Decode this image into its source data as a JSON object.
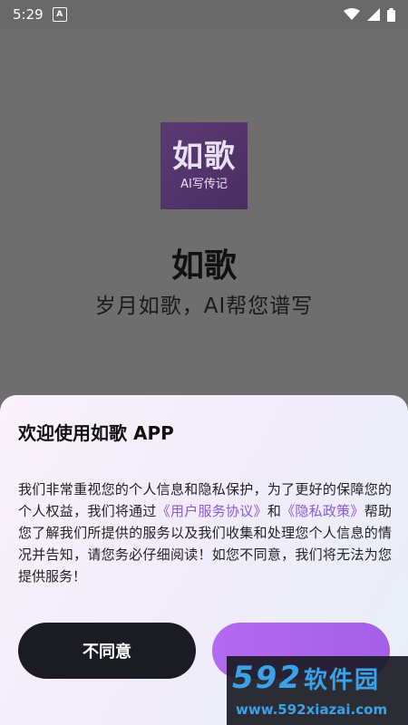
{
  "statusbar": {
    "time": "5:29",
    "notification_badge": "A"
  },
  "splash": {
    "logo_main": "如歌",
    "logo_sub": "AI写传记",
    "app_name": "如歌",
    "slogan": "岁月如歌，AI帮您谱写"
  },
  "dialog": {
    "title": "欢迎使用如歌 APP",
    "body_part1": "我们非常重视您的个人信息和隐私保护，为了更好的保障您的个人权益，我们将通过",
    "link_user_agreement": "《用户服务协议》",
    "body_part2": "和",
    "link_privacy_policy": "《隐私政策》",
    "body_part3": "帮助您了解我们所提供的服务以及我们收集和处理您个人信息的情况并告知，请您务必仔细阅读！如您不同意，我们将无法为您提供服务！",
    "disagree_label": "不同意",
    "agree_label": ""
  },
  "watermark": {
    "brand_number": "592",
    "brand_text": "软件园",
    "url": "www.592xiazai.com"
  },
  "colors": {
    "accent": "#a45fe8",
    "logo_bg": "#4a2e62",
    "dark_button": "#1b1b24",
    "watermark_blue": "#3aa3e8"
  }
}
